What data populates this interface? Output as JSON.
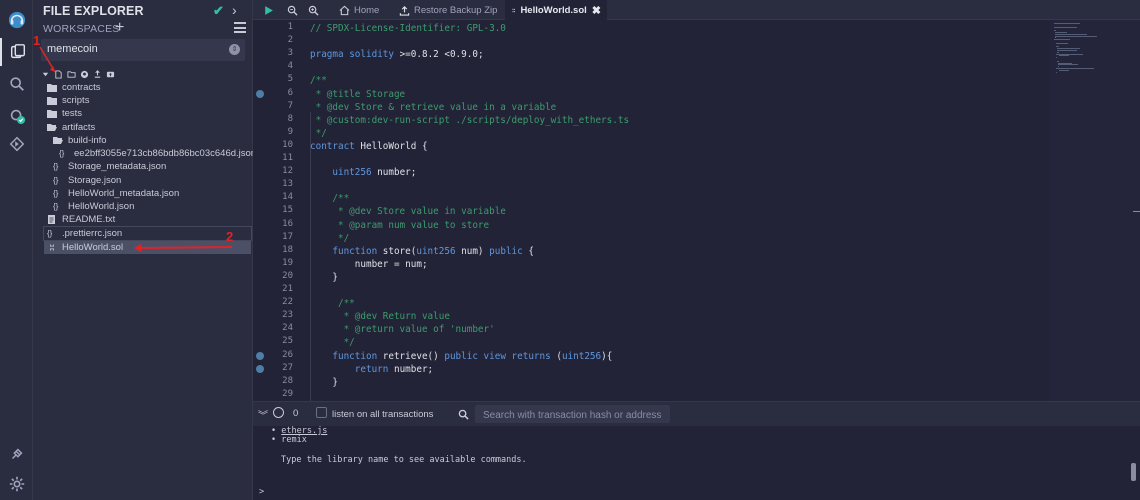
{
  "explorer": {
    "title": "FILE EXPLORER",
    "workspaces_label": "WORKSPACES",
    "workspace_selected": "memecoin",
    "tree": [
      {
        "label": "contracts",
        "type": "folder"
      },
      {
        "label": "scripts",
        "type": "folder"
      },
      {
        "label": "tests",
        "type": "folder"
      },
      {
        "label": "artifacts",
        "type": "folder-open"
      },
      {
        "label": "build-info",
        "type": "folder-open"
      },
      {
        "label": "ee2bff3055e713cb86bdb86bc03c646d.json",
        "type": "json"
      },
      {
        "label": "Storage_metadata.json",
        "type": "json"
      },
      {
        "label": "Storage.json",
        "type": "json"
      },
      {
        "label": "HelloWorld_metadata.json",
        "type": "json"
      },
      {
        "label": "HelloWorld.json",
        "type": "json"
      },
      {
        "label": "README.txt",
        "type": "text"
      },
      {
        "label": ".prettierrc.json",
        "type": "json"
      },
      {
        "label": "HelloWorld.sol",
        "type": "sol",
        "selected": true
      }
    ]
  },
  "annotations": {
    "one": "1",
    "two": "2",
    "color": "#e02424"
  },
  "tabs": [
    {
      "label": "Home",
      "icon": "home-icon"
    },
    {
      "label": "Restore Backup Zip",
      "icon": "upload-icon"
    },
    {
      "label": "HelloWorld.sol",
      "icon": "solidity-icon",
      "active": true
    }
  ],
  "editor": {
    "lines": [
      {
        "n": "1",
        "text": "// SPDX-License-Identifier: GPL-3.0"
      },
      {
        "n": "2",
        "text": ""
      },
      {
        "n": "3",
        "text": "pragma solidity >=0.8.2 <0.9.0;"
      },
      {
        "n": "4",
        "text": ""
      },
      {
        "n": "5",
        "text": "/**"
      },
      {
        "n": "6",
        "text": " * @title Storage"
      },
      {
        "n": "7",
        "text": " * @dev Store & retrieve value in a variable"
      },
      {
        "n": "8",
        "text": " * @custom:dev-run-script ./scripts/deploy_with_ethers.ts"
      },
      {
        "n": "9",
        "text": " */"
      },
      {
        "n": "10",
        "text": "contract HelloWorld {"
      },
      {
        "n": "11",
        "text": ""
      },
      {
        "n": "12",
        "text": "    uint256 number;"
      },
      {
        "n": "13",
        "text": ""
      },
      {
        "n": "14",
        "text": "    /**"
      },
      {
        "n": "15",
        "text": "     * @dev Store value in variable"
      },
      {
        "n": "16",
        "text": "     * @param num value to store"
      },
      {
        "n": "17",
        "text": "     */"
      },
      {
        "n": "18",
        "text": "    function store(uint256 num) public {"
      },
      {
        "n": "19",
        "text": "        number = num;"
      },
      {
        "n": "20",
        "text": "    }"
      },
      {
        "n": "21",
        "text": ""
      },
      {
        "n": "22",
        "text": "     /**"
      },
      {
        "n": "23",
        "text": "      * @dev Return value"
      },
      {
        "n": "24",
        "text": "      * @return value of 'number'"
      },
      {
        "n": "25",
        "text": "      */"
      },
      {
        "n": "26",
        "text": "    function retrieve() public view returns (uint256){"
      },
      {
        "n": "27",
        "text": "        return number;"
      },
      {
        "n": "28",
        "text": "    }"
      },
      {
        "n": "29",
        "text": ""
      }
    ],
    "keyword_color": "#5f97dd",
    "comment_color": "#3d9c6e"
  },
  "terminal": {
    "pending_count": "0",
    "listen_label": "listen on all transactions",
    "search_placeholder": "Search with transaction hash or address",
    "output": [
      {
        "bullet": "•",
        "text": "ethers.js"
      },
      {
        "bullet": "•",
        "text": "remix"
      },
      {
        "bullet": "",
        "text": ""
      },
      {
        "bullet": "",
        "text": "Type the library name to see available commands."
      }
    ],
    "prompt": ">"
  },
  "colors": {
    "accent_green": "#2fbfa3",
    "background": "#222336",
    "panel": "#2a2c3f"
  }
}
